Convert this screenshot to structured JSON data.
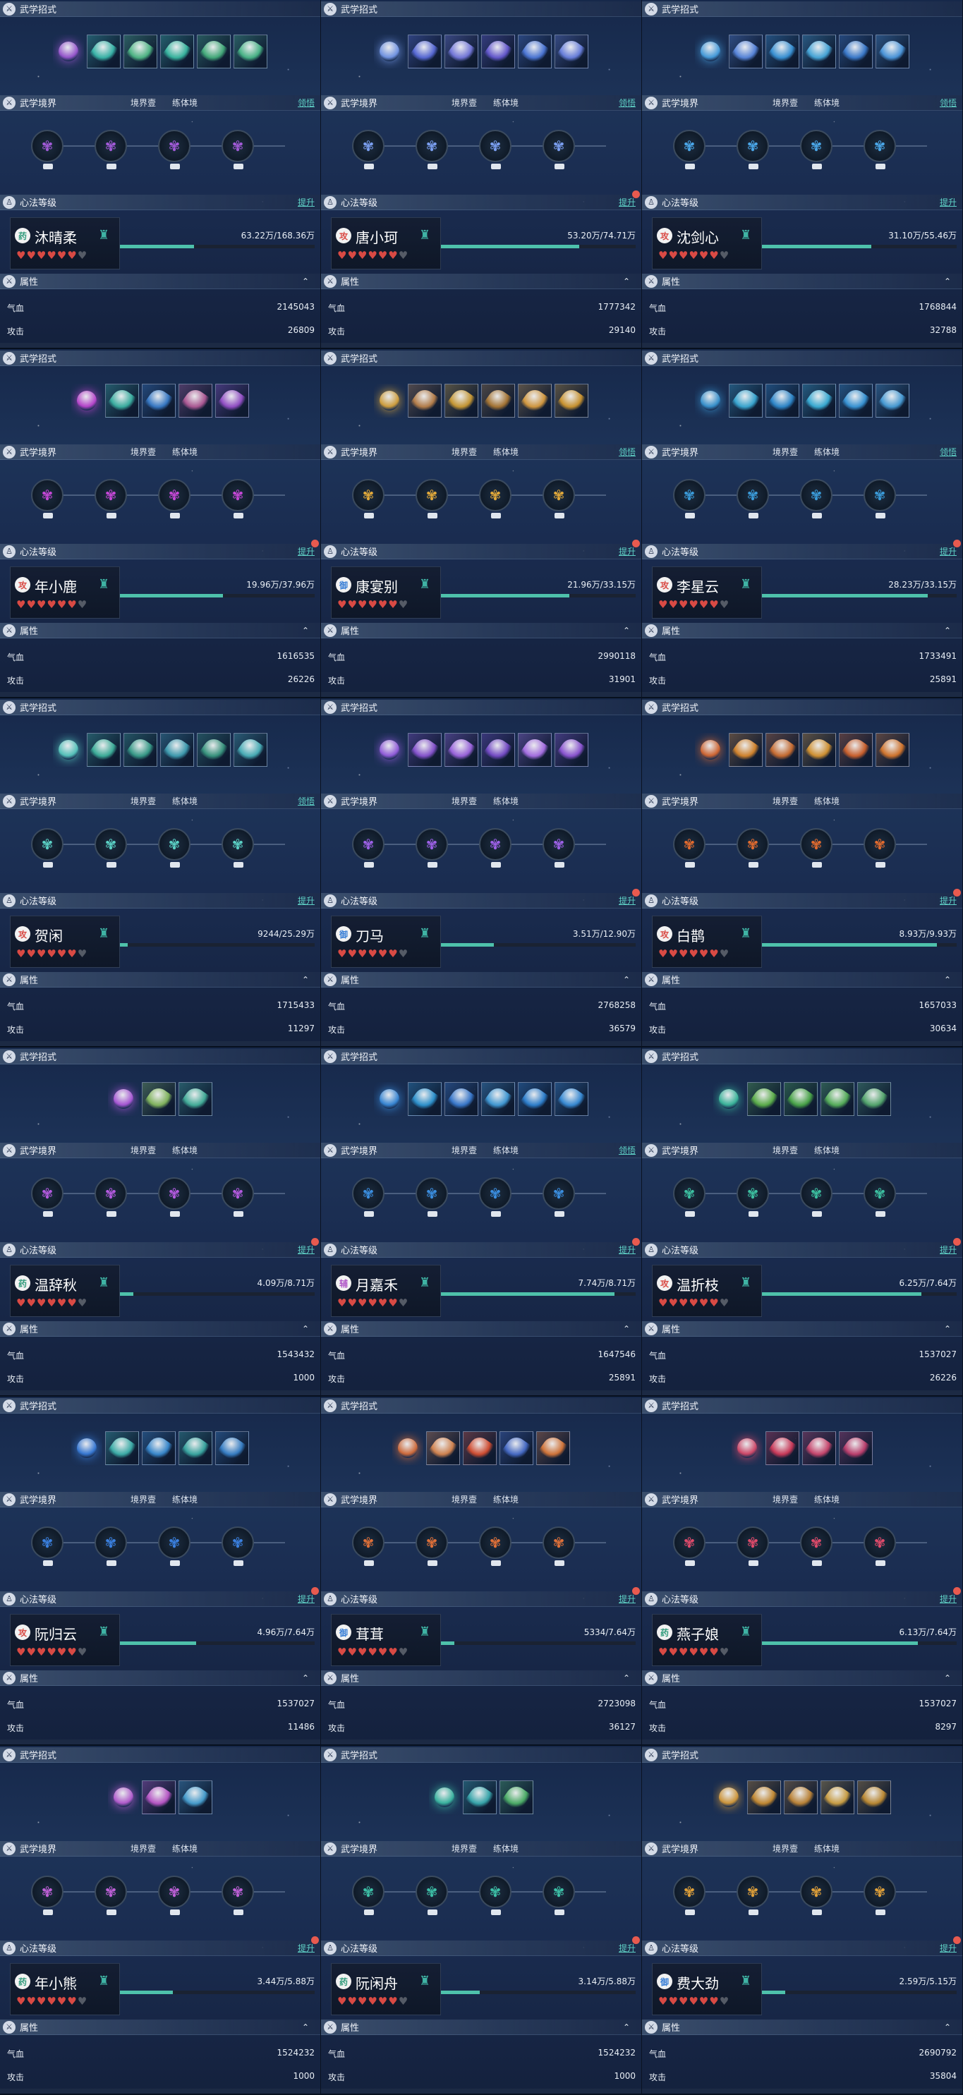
{
  "labels": {
    "skills_header": "武学招式",
    "realm_header": "武学境界",
    "realm_level": "境界壹",
    "realm_practice": "练体境",
    "realm_link": "领悟",
    "heart_header": "心法等级",
    "heart_link": "提升",
    "attr_header": "属性",
    "hp_label": "气血",
    "atk_label": "攻击"
  },
  "colors": {
    "accent": "#4ec1ab",
    "link": "#5fd1c6",
    "heart": "#d94a44",
    "red_dot": "#e85a4f"
  },
  "characters": [
    {
      "name": "沐晴柔",
      "badge": "药",
      "badge_color": "#2f9a7a",
      "sect_icon": "seal-icon",
      "hearts_full": 6,
      "hearts_total": 7,
      "xp": "63.22万/168.36万",
      "xp_progress": 0.38,
      "hp": "2145043",
      "atk": "26809",
      "skill_colors": [
        "#a25ad8",
        "#3bbfb0",
        "#53c18a",
        "#3ac0a6",
        "#46b47e",
        "#4cbf8c"
      ],
      "nodes": 4,
      "show_link": true,
      "heart_dot": false
    },
    {
      "name": "唐小珂",
      "badge": "攻",
      "badge_color": "#d94a44",
      "sect_icon": "seal-icon",
      "hearts_full": 6,
      "hearts_total": 7,
      "xp": "53.20万/74.71万",
      "xp_progress": 0.71,
      "hp": "1777342",
      "atk": "29140",
      "skill_colors": [
        "#7a9ef0",
        "#5c6ee0",
        "#7b7ee6",
        "#6a5cd8",
        "#4f7ce0",
        "#6f86e8"
      ],
      "nodes": 4,
      "show_link": true,
      "heart_dot": true
    },
    {
      "name": "沈剑心",
      "badge": "攻",
      "badge_color": "#d94a44",
      "sect_icon": "seal-icon",
      "hearts_full": 6,
      "hearts_total": 7,
      "xp": "31.10万/55.46万",
      "xp_progress": 0.56,
      "hp": "1768844",
      "atk": "32788",
      "skill_colors": [
        "#4aa6e8",
        "#5c8ce6",
        "#3b9ae0",
        "#4ab0e4",
        "#3d80d6",
        "#4f9ee6"
      ],
      "nodes": 4,
      "show_link": true,
      "heart_dot": false
    },
    {
      "name": "年小鹿",
      "badge": "攻",
      "badge_color": "#d94a44",
      "sect_icon": "seal-icon",
      "hearts_full": 6,
      "hearts_total": 7,
      "xp": "19.96万/37.96万",
      "xp_progress": 0.53,
      "hp": "1616535",
      "atk": "26226",
      "skill_colors": [
        "#c547d6",
        "#3db9a8",
        "#3a80d0",
        "#b85c9a",
        "#9c52d0"
      ],
      "nodes": 4,
      "show_link": false,
      "heart_dot": true
    },
    {
      "name": "康宴别",
      "badge": "御",
      "badge_color": "#3a7fd6",
      "sect_icon": "seal-icon",
      "hearts_full": 6,
      "hearts_total": 7,
      "xp": "21.96万/33.15万",
      "xp_progress": 0.66,
      "hp": "2990118",
      "atk": "31901",
      "skill_colors": [
        "#e0a83a",
        "#c0844a",
        "#d4a032",
        "#b07a32",
        "#e0a03e",
        "#d89c2e"
      ],
      "nodes": 4,
      "show_link": true,
      "heart_dot": true
    },
    {
      "name": "李星云",
      "badge": "攻",
      "badge_color": "#d94a44",
      "sect_icon": "seal-icon",
      "hearts_full": 6,
      "hearts_total": 7,
      "xp": "28.23万/33.15万",
      "xp_progress": 0.85,
      "hp": "1733491",
      "atk": "25891",
      "skill_colors": [
        "#3a9ad8",
        "#3bb0dc",
        "#2f8ed4",
        "#3cb6e0",
        "#3a9ce0",
        "#4aa4e0"
      ],
      "nodes": 4,
      "show_link": true,
      "heart_dot": true
    },
    {
      "name": "贺闲",
      "badge": "攻",
      "badge_color": "#d94a44",
      "sect_icon": "seal-icon",
      "hearts_full": 6,
      "hearts_total": 7,
      "xp": "9244/25.29万",
      "xp_progress": 0.04,
      "hp": "1715433",
      "atk": "11297",
      "skill_colors": [
        "#5ad0c4",
        "#3fb8a0",
        "#3aa48e",
        "#41a4b8",
        "#3a9c82",
        "#4cb8c0"
      ],
      "nodes": 4,
      "show_link": true,
      "heart_dot": false
    },
    {
      "name": "刀马",
      "badge": "御",
      "badge_color": "#3a7fd6",
      "sect_icon": "seal-icon",
      "hearts_full": 6,
      "hearts_total": 7,
      "xp": "3.51万/12.90万",
      "xp_progress": 0.27,
      "hp": "2768258",
      "atk": "36579",
      "skill_colors": [
        "#9c60e6",
        "#8e56d8",
        "#a468e8",
        "#7c4ed0",
        "#b074ee",
        "#9458dc"
      ],
      "nodes": 4,
      "show_link": false,
      "heart_dot": true
    },
    {
      "name": "白鹊",
      "badge": "攻",
      "badge_color": "#d94a44",
      "sect_icon": "seal-icon",
      "hearts_full": 6,
      "hearts_total": 7,
      "xp": "8.93万/9.93万",
      "xp_progress": 0.9,
      "hp": "1657033",
      "atk": "30634",
      "skill_colors": [
        "#e06a2e",
        "#e08a2a",
        "#d4702e",
        "#e09a30",
        "#d8642a",
        "#e07a2a"
      ],
      "nodes": 4,
      "show_link": false,
      "heart_dot": true
    },
    {
      "name": "温辞秋",
      "badge": "药",
      "badge_color": "#2f9a7a",
      "sect_icon": "seal-icon",
      "hearts_full": 6,
      "hearts_total": 7,
      "xp": "4.09万/8.71万",
      "xp_progress": 0.07,
      "hp": "1543432",
      "atk": "1000",
      "skill_colors": [
        "#b45ae0",
        "#8ac060",
        "#46b8a0"
      ],
      "nodes": 4,
      "show_link": false,
      "heart_dot": true
    },
    {
      "name": "月嘉禾",
      "badge": "辅",
      "badge_color": "#b056c8",
      "sect_icon": "seal-icon",
      "hearts_full": 6,
      "hearts_total": 7,
      "xp": "7.74万/8.71万",
      "xp_progress": 0.89,
      "hp": "1647546",
      "atk": "25891",
      "skill_colors": [
        "#3a8ee0",
        "#2f9ad8",
        "#3b7ed6",
        "#44a2e0",
        "#2f86d8",
        "#3a92e0"
      ],
      "nodes": 4,
      "show_link": true,
      "heart_dot": true
    },
    {
      "name": "温折枝",
      "badge": "攻",
      "badge_color": "#d94a44",
      "sect_icon": "seal-icon",
      "hearts_full": 6,
      "hearts_total": 7,
      "xp": "6.25万/7.64万",
      "xp_progress": 0.82,
      "hp": "1537027",
      "atk": "26226",
      "skill_colors": [
        "#3cc0a0",
        "#60b84a",
        "#4cae48",
        "#5ab85c",
        "#58b070"
      ],
      "nodes": 4,
      "show_link": false,
      "heart_dot": true
    },
    {
      "name": "阮归云",
      "badge": "攻",
      "badge_color": "#d94a44",
      "sect_icon": "seal-icon",
      "hearts_full": 6,
      "hearts_total": 7,
      "xp": "4.96万/7.64万",
      "xp_progress": 0.39,
      "hp": "1537027",
      "atk": "11486",
      "skill_colors": [
        "#3a80e0",
        "#3fb8b0",
        "#3b90d8",
        "#3cb0a8",
        "#3a86d0"
      ],
      "nodes": 4,
      "show_link": false,
      "heart_dot": true
    },
    {
      "name": "茸茸",
      "badge": "御",
      "badge_color": "#3a7fd6",
      "sect_icon": "seal-icon",
      "hearts_full": 6,
      "hearts_total": 7,
      "xp": "5334/7.64万",
      "xp_progress": 0.07,
      "hp": "2723098",
      "atk": "36127",
      "skill_colors": [
        "#e07038",
        "#e08a50",
        "#e05030",
        "#4a70d0",
        "#e07a38"
      ],
      "nodes": 4,
      "show_link": false,
      "heart_dot": true
    },
    {
      "name": "燕子娘",
      "badge": "药",
      "badge_color": "#2f9a7a",
      "sect_icon": "seal-icon",
      "hearts_full": 6,
      "hearts_total": 7,
      "xp": "6.13万/7.64万",
      "xp_progress": 0.8,
      "hp": "1537027",
      "atk": "8297",
      "skill_colors": [
        "#e04a6a",
        "#d83a5a",
        "#d64870",
        "#c84070"
      ],
      "nodes": 4,
      "show_link": false,
      "heart_dot": true
    },
    {
      "name": "年小熊",
      "badge": "药",
      "badge_color": "#2f9a7a",
      "sect_icon": "seal-icon",
      "hearts_full": 6,
      "hearts_total": 7,
      "xp": "3.44万/5.88万",
      "xp_progress": 0.27,
      "hp": "1524232",
      "atk": "1000",
      "skill_colors": [
        "#c060d8",
        "#c45ad0",
        "#4aa6d8"
      ],
      "nodes": 4,
      "show_link": false,
      "heart_dot": true
    },
    {
      "name": "阮闲舟",
      "badge": "药",
      "badge_color": "#2f9a7a",
      "sect_icon": "seal-icon",
      "hearts_full": 6,
      "hearts_total": 7,
      "xp": "3.14万/5.88万",
      "xp_progress": 0.2,
      "hp": "1524232",
      "atk": "1000",
      "skill_colors": [
        "#3cc0a6",
        "#3ab0b4",
        "#50b86a"
      ],
      "nodes": 4,
      "show_link": false,
      "heart_dot": true
    },
    {
      "name": "费大劲",
      "badge": "御",
      "badge_color": "#3a7fd6",
      "sect_icon": "seal-icon",
      "hearts_full": 6,
      "hearts_total": 7,
      "xp": "2.59万/5.15万",
      "xp_progress": 0.12,
      "hp": "2690792",
      "atk": "35804",
      "skill_colors": [
        "#e0a038",
        "#d09030",
        "#c88a36",
        "#d8a844",
        "#c89030"
      ],
      "nodes": 4,
      "show_link": false,
      "heart_dot": true
    }
  ]
}
